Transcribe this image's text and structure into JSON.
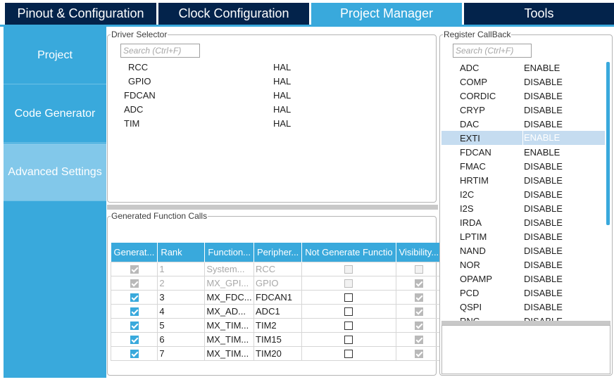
{
  "tabs": [
    {
      "label": "Pinout & Configuration"
    },
    {
      "label": "Clock Configuration"
    },
    {
      "label": "Project Manager"
    },
    {
      "label": "Tools"
    }
  ],
  "sidenav": [
    {
      "label": "Project"
    },
    {
      "label": "Code Generator"
    },
    {
      "label": "Advanced Settings"
    }
  ],
  "driver_selector": {
    "title": "Driver Selector",
    "search_placeholder": "Search (Ctrl+F)",
    "rows": [
      {
        "name": "RCC",
        "driver": "HAL"
      },
      {
        "name": "GPIO",
        "driver": "HAL"
      },
      {
        "name": "FDCAN",
        "driver": "HAL"
      },
      {
        "name": "ADC",
        "driver": "HAL"
      },
      {
        "name": "TIM",
        "driver": "HAL"
      }
    ]
  },
  "generated_calls": {
    "title": "Generated Function Calls",
    "columns": [
      "Generat...",
      "Rank",
      "Function...",
      "Peripher...",
      "Not Generate Functio",
      "Visibility..."
    ],
    "rows": [
      {
        "rank": "1",
        "function": "System...",
        "peripheral": "RCC",
        "generate": true,
        "not_generate": false,
        "visibility": false,
        "disabled": true
      },
      {
        "rank": "2",
        "function": "MX_GPI...",
        "peripheral": "GPIO",
        "generate": true,
        "not_generate": false,
        "visibility": true,
        "disabled": true
      },
      {
        "rank": "3",
        "function": "MX_FDC...",
        "peripheral": "FDCAN1",
        "generate": true,
        "not_generate": false,
        "visibility": true,
        "disabled": false
      },
      {
        "rank": "4",
        "function": "MX_AD...",
        "peripheral": "ADC1",
        "generate": true,
        "not_generate": false,
        "visibility": true,
        "disabled": false
      },
      {
        "rank": "5",
        "function": "MX_TIM...",
        "peripheral": "TIM2",
        "generate": true,
        "not_generate": false,
        "visibility": true,
        "disabled": false
      },
      {
        "rank": "6",
        "function": "MX_TIM...",
        "peripheral": "TIM15",
        "generate": true,
        "not_generate": false,
        "visibility": true,
        "disabled": false
      },
      {
        "rank": "7",
        "function": "MX_TIM...",
        "peripheral": "TIM20",
        "generate": true,
        "not_generate": false,
        "visibility": true,
        "disabled": false
      }
    ]
  },
  "register_callback": {
    "title": "Register CallBack",
    "search_placeholder": "Search (Ctrl+F)",
    "selected": "EXTI",
    "items": [
      {
        "name": "ADC",
        "value": "ENABLE"
      },
      {
        "name": "COMP",
        "value": "DISABLE"
      },
      {
        "name": "CORDIC",
        "value": "DISABLE"
      },
      {
        "name": "CRYP",
        "value": "DISABLE"
      },
      {
        "name": "DAC",
        "value": "DISABLE"
      },
      {
        "name": "EXTI",
        "value": "ENABLE"
      },
      {
        "name": "FDCAN",
        "value": "ENABLE"
      },
      {
        "name": "FMAC",
        "value": "DISABLE"
      },
      {
        "name": "HRTIM",
        "value": "DISABLE"
      },
      {
        "name": "I2C",
        "value": "DISABLE"
      },
      {
        "name": "I2S",
        "value": "DISABLE"
      },
      {
        "name": "IRDA",
        "value": "DISABLE"
      },
      {
        "name": "LPTIM",
        "value": "DISABLE"
      },
      {
        "name": "NAND",
        "value": "DISABLE"
      },
      {
        "name": "NOR",
        "value": "DISABLE"
      },
      {
        "name": "OPAMP",
        "value": "DISABLE"
      },
      {
        "name": "PCD",
        "value": "DISABLE"
      },
      {
        "name": "QSPI",
        "value": "DISABLE"
      },
      {
        "name": "RNG",
        "value": "DISABLE"
      }
    ]
  },
  "colors": {
    "tab_dark": "#03234b",
    "accent": "#39a9dc",
    "nav_active": "#82c8ea",
    "row_selected": "#c5dcf0"
  }
}
